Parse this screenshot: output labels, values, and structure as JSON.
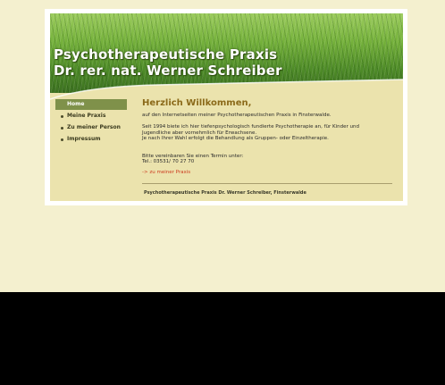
{
  "header": {
    "title_line1": "Psychotherapeutische Praxis",
    "title_line2": "Dr. rer. nat. Werner Schreiber"
  },
  "nav": {
    "items": [
      {
        "label": "Home",
        "active": true
      },
      {
        "label": "Meine Praxis",
        "active": false
      },
      {
        "label": "Zu meiner Person",
        "active": false
      },
      {
        "label": "Impressum",
        "active": false
      }
    ]
  },
  "content": {
    "heading": "Herzlich Willkommen,",
    "intro": "auf den Internetseiten meiner Psychotherapeutischen Praxis in Finsterwalde.",
    "para1": "Seit 1994 biete ich hier tiefenpsychologisch fundierte Psychotherapie an, für Kinder und Jugendliche aber vornehmlich für Erwachsene.",
    "para2": "Je nach Ihrer Wahl erfolgt die Behandlung als Gruppen- oder Einzeltherapie.",
    "appointment": "Bitte vereinbaren Sie einen Termin unter:",
    "phone": "Tel.: 03531/ 70 27 70",
    "link": "-> zu meiner Praxis"
  },
  "footer": {
    "text": "Psychotherapeutische Praxis Dr. Werner Schreiber, Finsterwalde"
  },
  "colors": {
    "background": "#f4f0cf",
    "page": "#ebe3ad",
    "nav_active": "#7f914a",
    "heading": "#8b6a1a",
    "link": "#cc3a1e"
  }
}
